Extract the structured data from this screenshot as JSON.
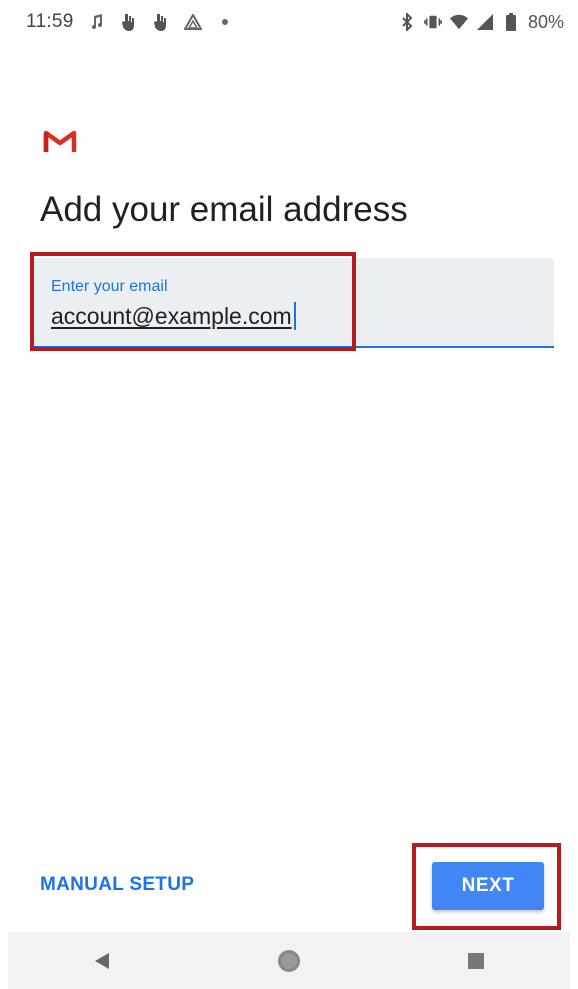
{
  "status_bar": {
    "time": "11:59",
    "notification_icons": [
      "music-note-icon",
      "hand-icon",
      "hand-icon",
      "triangle-icon",
      "dot-icon"
    ],
    "system_icons": [
      "bluetooth-icon",
      "vibrate-icon",
      "wifi-icon",
      "signal-icon",
      "battery-icon"
    ],
    "battery": "80%"
  },
  "logo": "gmail-logo",
  "page": {
    "title": "Add your email address"
  },
  "email_field": {
    "label": "Enter your email",
    "value": "account@example.com"
  },
  "actions": {
    "manual_setup_label": "MANUAL SETUP",
    "next_label": "NEXT"
  },
  "nav_bar": {
    "back": "back-icon",
    "home": "home-icon",
    "recents": "recents-icon"
  },
  "colors": {
    "accent": "#1a73e8",
    "button": "#4285f4",
    "highlight": "#b71c1c",
    "gmail_red": "#d93025"
  }
}
